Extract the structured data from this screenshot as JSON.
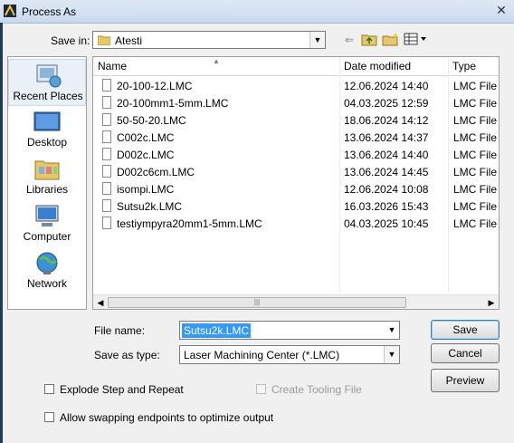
{
  "window": {
    "title": "Process As"
  },
  "save_in": {
    "label": "Save in:",
    "value": "Atesti"
  },
  "places": [
    {
      "label": "Recent Places",
      "icon": "recent-places-icon"
    },
    {
      "label": "Desktop",
      "icon": "desktop-icon"
    },
    {
      "label": "Libraries",
      "icon": "libraries-icon"
    },
    {
      "label": "Computer",
      "icon": "computer-icon"
    },
    {
      "label": "Network",
      "icon": "network-icon"
    }
  ],
  "columns": {
    "name": "Name",
    "date": "Date modified",
    "type": "Type"
  },
  "files": [
    {
      "name": "20-100-12.LMC",
      "date": "12.06.2024 14:40",
      "type": "LMC File"
    },
    {
      "name": "20-100mm1-5mm.LMC",
      "date": "04.03.2025 12:59",
      "type": "LMC File"
    },
    {
      "name": "50-50-20.LMC",
      "date": "18.06.2024 14:12",
      "type": "LMC File"
    },
    {
      "name": "C002c.LMC",
      "date": "13.06.2024 14:37",
      "type": "LMC File"
    },
    {
      "name": "D002c.LMC",
      "date": "13.06.2024 14:40",
      "type": "LMC File"
    },
    {
      "name": "D002c6cm.LMC",
      "date": "13.06.2024 14:45",
      "type": "LMC File"
    },
    {
      "name": "isompi.LMC",
      "date": "12.06.2024 10:08",
      "type": "LMC File"
    },
    {
      "name": "Sutsu2k.LMC",
      "date": "16.03.2026 15:43",
      "type": "LMC File"
    },
    {
      "name": "testiympyra20mm1-5mm.LMC",
      "date": "04.03.2025 10:45",
      "type": "LMC File"
    }
  ],
  "file_name": {
    "label": "File name:",
    "value": "Sutsu2k.LMC"
  },
  "save_as_type": {
    "label": "Save as type:",
    "value": "Laser Machining Center (*.LMC)"
  },
  "buttons": {
    "save": "Save",
    "cancel": "Cancel",
    "preview": "Preview"
  },
  "options": {
    "explode": {
      "label": "Explode Step and Repeat",
      "checked": false
    },
    "tooling": {
      "label": "Create Tooling File",
      "checked": false,
      "enabled": false
    },
    "swap": {
      "label": "Allow swapping endpoints to optimize output",
      "checked": false
    }
  },
  "colors": {
    "selection": "#3399ff",
    "title_gradient_top": "#dfe9f5"
  }
}
